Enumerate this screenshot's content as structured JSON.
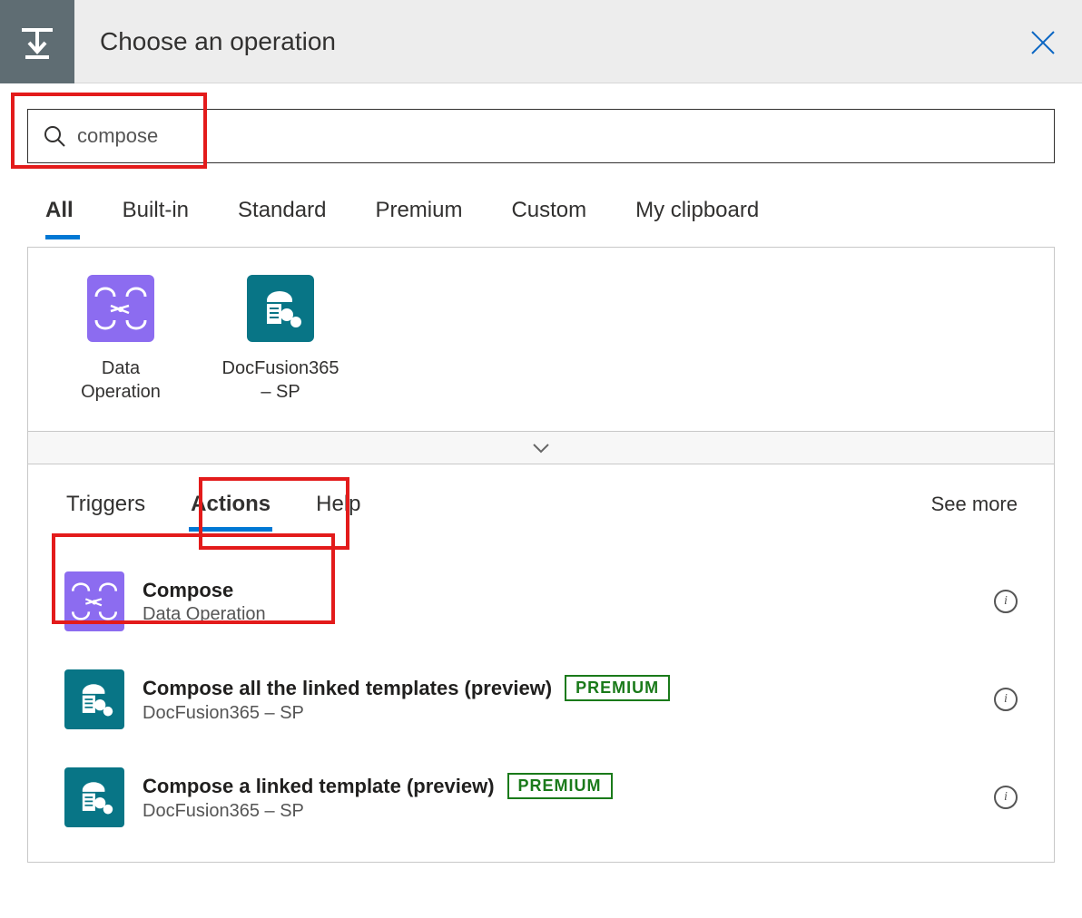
{
  "header": {
    "title": "Choose an operation"
  },
  "search": {
    "value": "compose"
  },
  "filter_tabs": [
    {
      "label": "All",
      "active": true
    },
    {
      "label": "Built-in"
    },
    {
      "label": "Standard"
    },
    {
      "label": "Premium"
    },
    {
      "label": "Custom"
    },
    {
      "label": "My clipboard"
    }
  ],
  "connectors": [
    {
      "label": "Data Operation",
      "icon": "data-operation"
    },
    {
      "label": "DocFusion365 – SP",
      "icon": "docfusion"
    }
  ],
  "sub_tabs": {
    "triggers": "Triggers",
    "actions": "Actions",
    "help": "Help",
    "see_more": "See more"
  },
  "actions": [
    {
      "title": "Compose",
      "subtitle": "Data Operation",
      "icon": "data-operation",
      "premium": false
    },
    {
      "title": "Compose all the linked templates (preview)",
      "subtitle": "DocFusion365 – SP",
      "icon": "docfusion",
      "premium": true,
      "premium_label": "PREMIUM"
    },
    {
      "title": "Compose a linked template (preview)",
      "subtitle": "DocFusion365 – SP",
      "icon": "docfusion",
      "premium": true,
      "premium_label": "PREMIUM"
    }
  ]
}
